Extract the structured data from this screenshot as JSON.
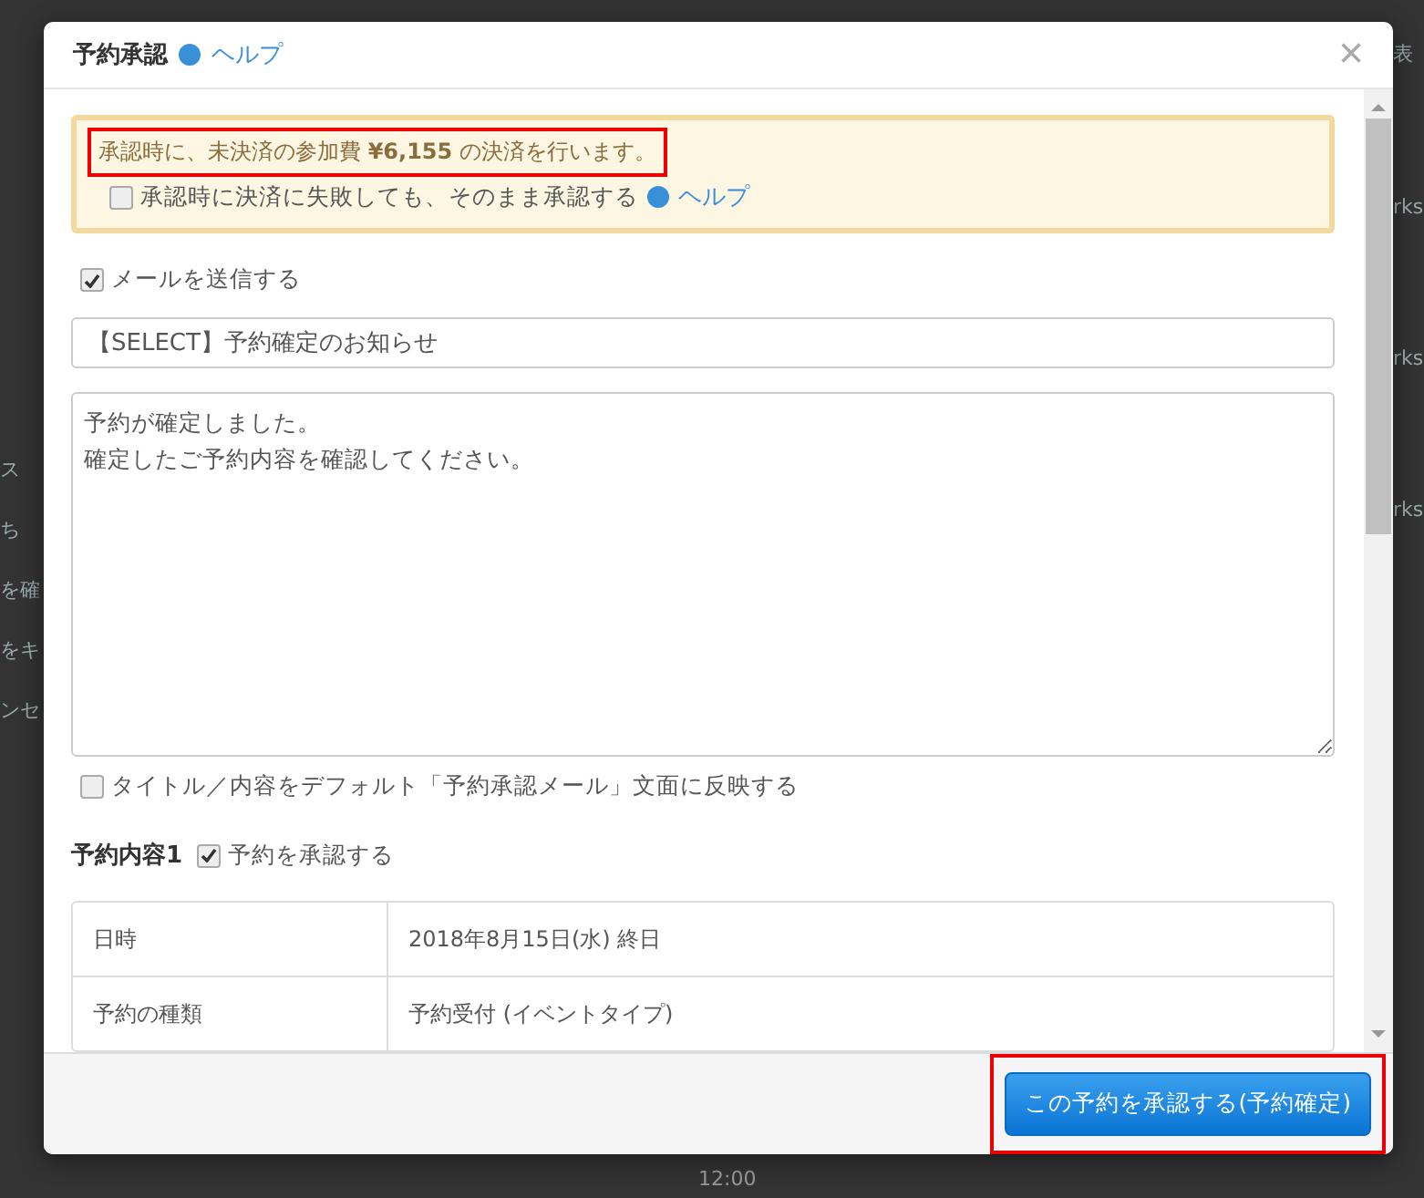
{
  "background": {
    "left_fragments": [
      "ス",
      "ち",
      "を確",
      "をキ",
      "ンセ"
    ],
    "right_fragments": [
      "表",
      "rks",
      "rks",
      "rks"
    ],
    "bottom_fragment": "12:00"
  },
  "dialog": {
    "title": "予約承認",
    "help_link": "ヘルプ",
    "close": "×"
  },
  "notice": {
    "message": "承認時に、未決済の参加費 **¥6,155** の決済を行います。",
    "highlighted": true,
    "option": {
      "label": "承認時に決済に失敗しても、そのまま承認する",
      "checked": false
    },
    "help_link": "ヘルプ"
  },
  "send_mail": {
    "label": "メールを送信する",
    "checked": true
  },
  "subject": {
    "value": "【SELECT】予約確定のお知らせ"
  },
  "body": {
    "lines": [
      "予約が確定しました。",
      "確定したご予約内容を確認してください。"
    ]
  },
  "reflect_default": {
    "label": "タイトル／内容をデフォルト「予約承認メール」文面に反映する",
    "checked": false
  },
  "section": {
    "heading": "予約内容1",
    "approve": {
      "label": "予約を承認する",
      "checked": true
    }
  },
  "details": [
    {
      "label": "日時",
      "value": "2018年8月15日(水) 終日"
    },
    {
      "label": "予約の種類",
      "value": "予約受付 (イベントタイプ)"
    }
  ],
  "footer": {
    "button": "この予約を承認する(予約確定)",
    "highlighted": true
  }
}
